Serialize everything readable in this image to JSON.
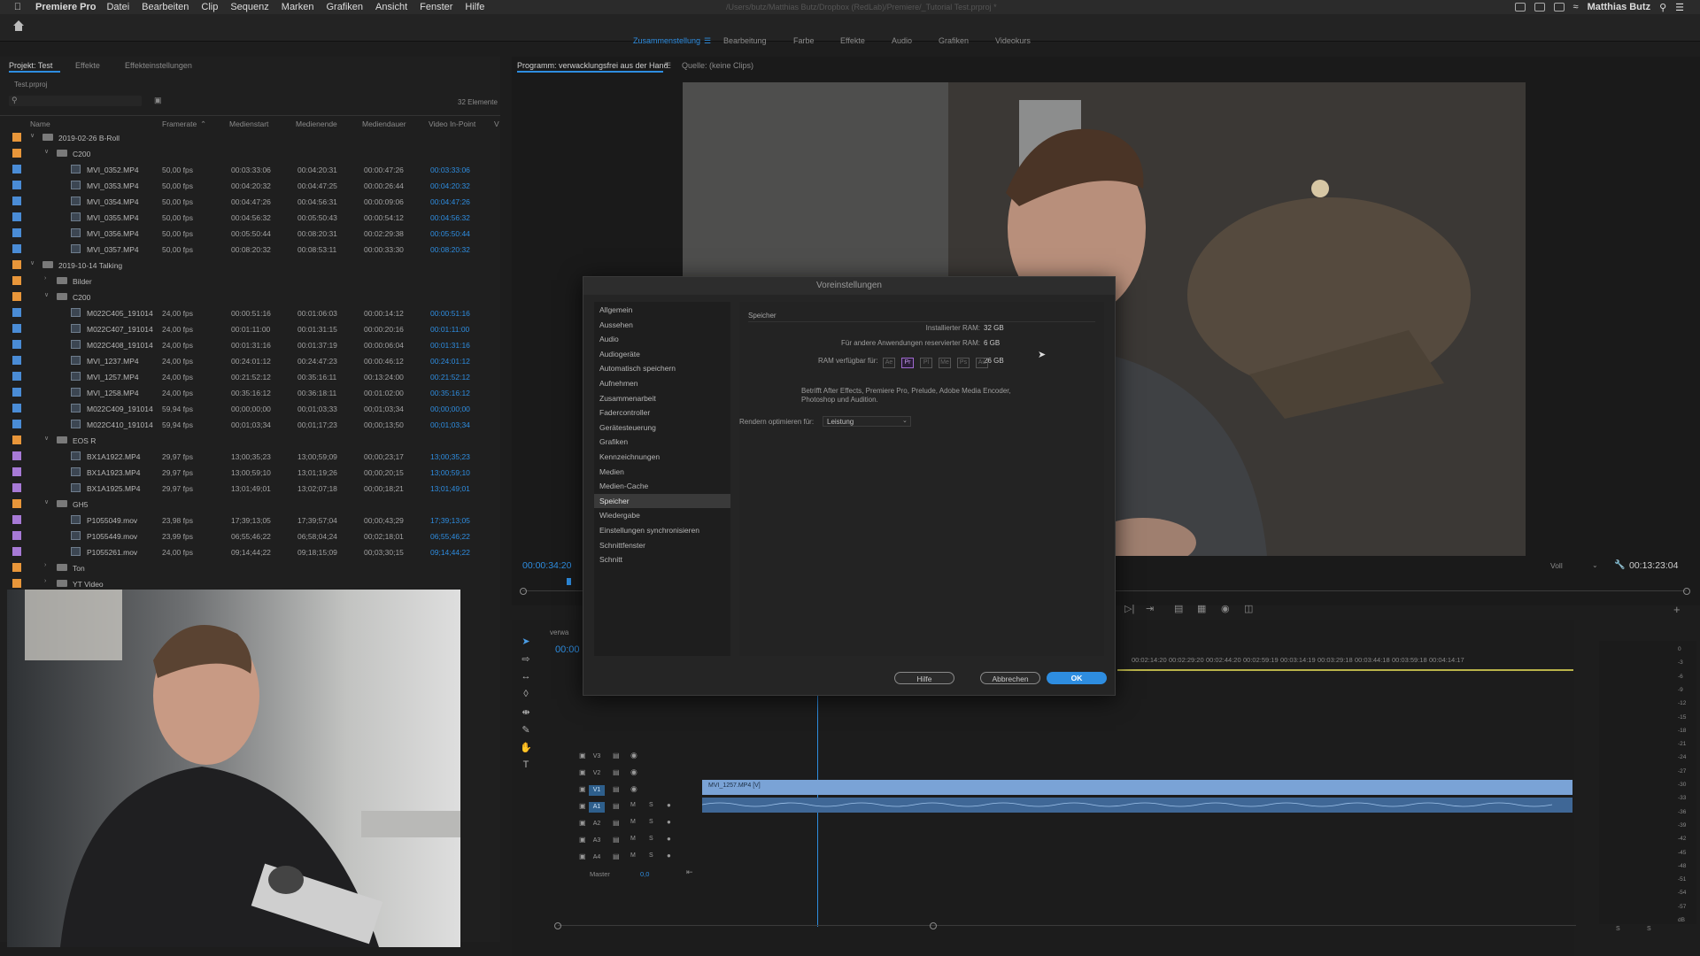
{
  "menubar": {
    "app": "Premiere Pro",
    "items": [
      "Datei",
      "Bearbeiten",
      "Clip",
      "Sequenz",
      "Marken",
      "Grafiken",
      "Ansicht",
      "Fenster",
      "Hilfe"
    ],
    "path": "/Users/butz/Matthias Butz/Dropbox (RedLab)/Premiere/_Tutorial Test.prproj *",
    "user": "Matthias Butz"
  },
  "workspaces": [
    "Zusammenstellung",
    "Bearbeitung",
    "Farbe",
    "Effekte",
    "Audio",
    "Grafiken",
    "Videokurs"
  ],
  "project_panel": {
    "tabs": [
      "Projekt: Test",
      "Effekte",
      "Effekteinstellungen"
    ],
    "file": "Test.prproj",
    "item_count": "32 Elemente",
    "columns": [
      "Name",
      "Framerate",
      "Medienstart",
      "Medienende",
      "Mediendauer",
      "Video In-Point",
      "V"
    ],
    "rows": [
      {
        "type": "folder",
        "depth": 0,
        "name": "2019-02-26 B-Roll",
        "color": "#e8963a",
        "open": true
      },
      {
        "type": "folder",
        "depth": 1,
        "name": "C200",
        "color": "#e8963a",
        "open": true
      },
      {
        "type": "clip",
        "depth": 2,
        "name": "MVI_0352.MP4",
        "fps": "50,00 fps",
        "start": "00:03:33:06",
        "end": "00:04:20:31",
        "dur": "00:00:47:26",
        "in": "00:03:33:06",
        "color": "#4a8cd6"
      },
      {
        "type": "clip",
        "depth": 2,
        "name": "MVI_0353.MP4",
        "fps": "50,00 fps",
        "start": "00:04:20:32",
        "end": "00:04:47:25",
        "dur": "00:00:26:44",
        "in": "00:04:20:32",
        "color": "#4a8cd6"
      },
      {
        "type": "clip",
        "depth": 2,
        "name": "MVI_0354.MP4",
        "fps": "50,00 fps",
        "start": "00:04:47:26",
        "end": "00:04:56:31",
        "dur": "00:00:09:06",
        "in": "00:04:47:26",
        "color": "#4a8cd6"
      },
      {
        "type": "clip",
        "depth": 2,
        "name": "MVI_0355.MP4",
        "fps": "50,00 fps",
        "start": "00:04:56:32",
        "end": "00:05:50:43",
        "dur": "00:00:54:12",
        "in": "00:04:56:32",
        "color": "#4a8cd6"
      },
      {
        "type": "clip",
        "depth": 2,
        "name": "MVI_0356.MP4",
        "fps": "50,00 fps",
        "start": "00:05:50:44",
        "end": "00:08:20:31",
        "dur": "00:02:29:38",
        "in": "00:05:50:44",
        "color": "#4a8cd6"
      },
      {
        "type": "clip",
        "depth": 2,
        "name": "MVI_0357.MP4",
        "fps": "50,00 fps",
        "start": "00:08:20:32",
        "end": "00:08:53:11",
        "dur": "00:00:33:30",
        "in": "00:08:20:32",
        "color": "#4a8cd6"
      },
      {
        "type": "folder",
        "depth": 0,
        "name": "2019-10-14 Talking",
        "color": "#e8963a",
        "open": true
      },
      {
        "type": "folder",
        "depth": 1,
        "name": "Bilder",
        "color": "#e8963a",
        "open": false
      },
      {
        "type": "folder",
        "depth": 1,
        "name": "C200",
        "color": "#e8963a",
        "open": true
      },
      {
        "type": "clip",
        "depth": 2,
        "name": "M022C405_191014",
        "fps": "24,00 fps",
        "start": "00:00:51:16",
        "end": "00:01:06:03",
        "dur": "00:00:14:12",
        "in": "00:00:51:16",
        "color": "#4a8cd6"
      },
      {
        "type": "clip",
        "depth": 2,
        "name": "M022C407_191014",
        "fps": "24,00 fps",
        "start": "00:01:11:00",
        "end": "00:01:31:15",
        "dur": "00:00:20:16",
        "in": "00:01:11:00",
        "color": "#4a8cd6"
      },
      {
        "type": "clip",
        "depth": 2,
        "name": "M022C408_191014",
        "fps": "24,00 fps",
        "start": "00:01:31:16",
        "end": "00:01:37:19",
        "dur": "00:00:06:04",
        "in": "00:01:31:16",
        "color": "#4a8cd6"
      },
      {
        "type": "clip",
        "depth": 2,
        "name": "MVI_1237.MP4",
        "fps": "24,00 fps",
        "start": "00:24:01:12",
        "end": "00:24:47:23",
        "dur": "00:00:46:12",
        "in": "00:24:01:12",
        "color": "#4a8cd6"
      },
      {
        "type": "clip",
        "depth": 2,
        "name": "MVI_1257.MP4",
        "fps": "24,00 fps",
        "start": "00:21:52:12",
        "end": "00:35:16:11",
        "dur": "00:13:24:00",
        "in": "00:21:52:12",
        "color": "#4a8cd6"
      },
      {
        "type": "clip",
        "depth": 2,
        "name": "MVI_1258.MP4",
        "fps": "24,00 fps",
        "start": "00:35:16:12",
        "end": "00:36:18:11",
        "dur": "00:01:02:00",
        "in": "00:35:16:12",
        "color": "#4a8cd6"
      },
      {
        "type": "clip",
        "depth": 2,
        "name": "M022C409_191014",
        "fps": "59,94 fps",
        "start": "00;00;00;00",
        "end": "00;01;03;33",
        "dur": "00;01;03;34",
        "in": "00;00;00;00",
        "color": "#4a8cd6"
      },
      {
        "type": "clip",
        "depth": 2,
        "name": "M022C410_191014",
        "fps": "59,94 fps",
        "start": "00;01;03;34",
        "end": "00;01;17;23",
        "dur": "00;00;13;50",
        "in": "00;01;03;34",
        "color": "#4a8cd6"
      },
      {
        "type": "folder",
        "depth": 1,
        "name": "EOS R",
        "color": "#e8963a",
        "open": true
      },
      {
        "type": "clip",
        "depth": 2,
        "name": "BX1A1922.MP4",
        "fps": "29,97 fps",
        "start": "13;00;35;23",
        "end": "13;00;59;09",
        "dur": "00;00;23;17",
        "in": "13;00;35;23",
        "color": "#a77ad6"
      },
      {
        "type": "clip",
        "depth": 2,
        "name": "BX1A1923.MP4",
        "fps": "29,97 fps",
        "start": "13;00;59;10",
        "end": "13;01;19;26",
        "dur": "00;00;20;15",
        "in": "13;00;59;10",
        "color": "#a77ad6"
      },
      {
        "type": "clip",
        "depth": 2,
        "name": "BX1A1925.MP4",
        "fps": "29,97 fps",
        "start": "13;01;49;01",
        "end": "13;02;07;18",
        "dur": "00;00;18;21",
        "in": "13;01;49;01",
        "color": "#a77ad6"
      },
      {
        "type": "folder",
        "depth": 1,
        "name": "GH5",
        "color": "#e8963a",
        "open": true
      },
      {
        "type": "clip",
        "depth": 2,
        "name": "P1055049.mov",
        "fps": "23,98 fps",
        "start": "17;39;13;05",
        "end": "17;39;57;04",
        "dur": "00;00;43;29",
        "in": "17;39;13;05",
        "color": "#a77ad6"
      },
      {
        "type": "clip",
        "depth": 2,
        "name": "P1055449.mov",
        "fps": "23,99 fps",
        "start": "06;55;46;22",
        "end": "06;58;04;24",
        "dur": "00;02;18;01",
        "in": "06;55;46;22",
        "color": "#a77ad6"
      },
      {
        "type": "clip",
        "depth": 2,
        "name": "P1055261.mov",
        "fps": "24,00 fps",
        "start": "09;14;44;22",
        "end": "09;18;15;09",
        "dur": "00;03;30;15",
        "in": "09;14;44;22",
        "color": "#a77ad6"
      },
      {
        "type": "folder",
        "depth": 1,
        "name": "Ton",
        "color": "#e8963a",
        "open": false
      },
      {
        "type": "folder",
        "depth": 1,
        "name": "YT Video",
        "color": "#e8963a",
        "open": false
      }
    ]
  },
  "program_monitor": {
    "tabs": [
      "Programm: verwacklungsfrei aus der Hand",
      "Quelle: (keine Clips)"
    ],
    "timecode": "00:00:34:20",
    "duration": "00:13:23:04",
    "zoom": "Voll"
  },
  "timeline": {
    "seq_tab": "verwa",
    "timecode": "00:00",
    "ruler": [
      "00:02:14:20",
      "00:02:29:20",
      "00:02:44:20",
      "00:02:59:19",
      "00:03:14:19",
      "00:03:29:18",
      "00:03:44:18",
      "00:03:59:18",
      "00:04:14:17"
    ],
    "tracks": [
      "V3",
      "V2",
      "V1",
      "A1",
      "A2",
      "A3",
      "A4"
    ],
    "master": "Master",
    "master_value": "0,0",
    "clip_label": "MVI_1257.MP4 [V]",
    "meter_labels": [
      "0",
      "-3",
      "-6",
      "-9",
      "-12",
      "-15",
      "-18",
      "-21",
      "-24",
      "-27",
      "-30",
      "-33",
      "-36",
      "-39",
      "-42",
      "-45",
      "-48",
      "-51",
      "-54",
      "-57",
      "dB"
    ],
    "meter_footer": [
      "S",
      "S"
    ]
  },
  "dialog": {
    "title": "Voreinstellungen",
    "nav": [
      "Allgemein",
      "Aussehen",
      "Audio",
      "Audiogeräte",
      "Automatisch speichern",
      "Aufnehmen",
      "Zusammenarbeit",
      "Fadercontroller",
      "Gerätesteuerung",
      "Grafiken",
      "Kennzeichnungen",
      "Medien",
      "Medien-Cache",
      "Speicher",
      "Wiedergabe",
      "Einstellungen synchronisieren",
      "Schnittfenster",
      "Schnitt"
    ],
    "selected_nav": "Speicher",
    "section": "Speicher",
    "installed_ram_label": "Installierter RAM:",
    "installed_ram": "32 GB",
    "reserved_label": "Für andere Anwendungen reservierter RAM:",
    "reserved": "6 GB",
    "available_label": "RAM verfügbar für:",
    "apps": [
      "Ae",
      "Pr",
      "Pl",
      "Me",
      "Ps",
      "Au"
    ],
    "active_app": "Pr",
    "available": "26 GB",
    "note": "Betrifft After Effects, Premiere Pro, Prelude, Adobe Media Encoder, Photoshop und Audition.",
    "render_label": "Rendern optimieren für:",
    "render_value": "Leistung",
    "buttons": {
      "help": "Hilfe",
      "cancel": "Abbrechen",
      "ok": "OK"
    }
  },
  "colors": {
    "accent": "#2e8de0",
    "folder": "#e8963a",
    "clip_blue": "#4a8cd6",
    "clip_purple": "#a77ad6"
  }
}
